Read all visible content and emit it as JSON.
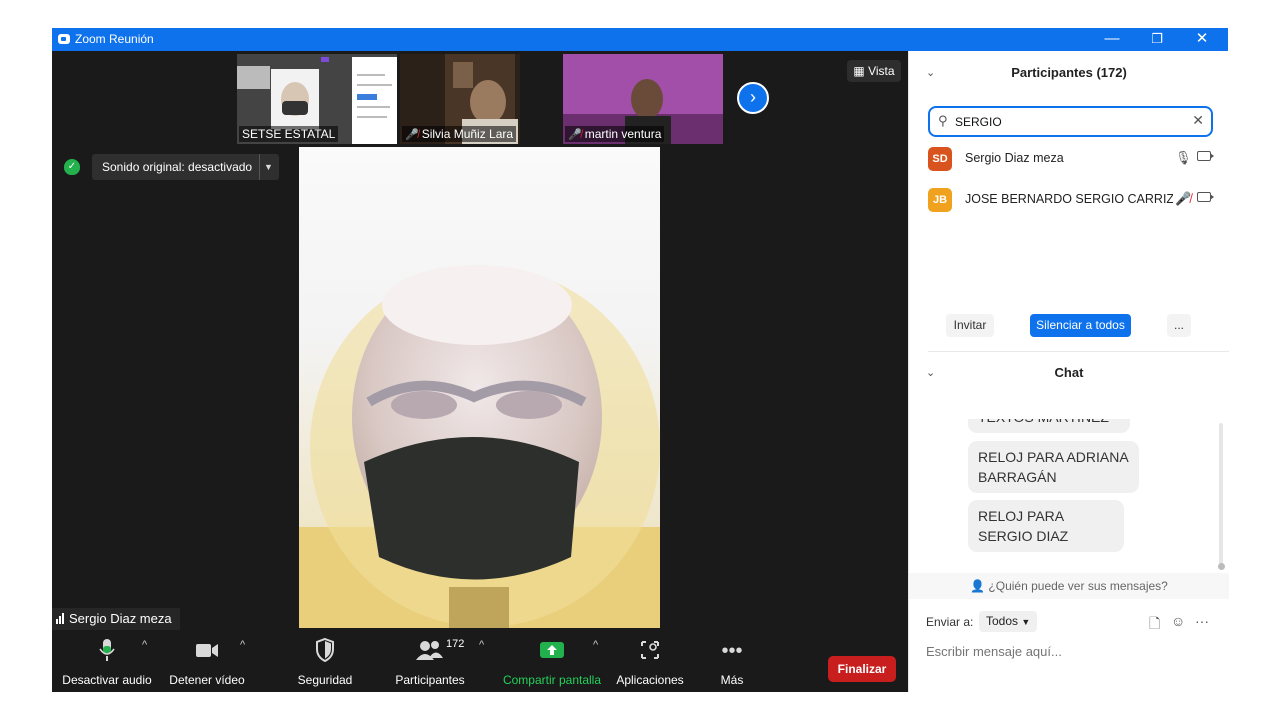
{
  "titlebar": {
    "title": "Zoom Reunión",
    "minimize": "—",
    "restore": "❐",
    "close": "✕"
  },
  "gallery": {
    "tiles": [
      {
        "name": "SETSE ESTATAL",
        "muted": false
      },
      {
        "name": "Silvia Muñiz Lara",
        "muted": true
      },
      {
        "name": "martin ventura",
        "muted": true
      }
    ],
    "next_icon": "›"
  },
  "view_button": "Vista",
  "sound_chip": "Sonido original: desactivado",
  "active_speaker": "Sergio Diaz meza",
  "toolbar": {
    "audio": "Desactivar audio",
    "video": "Detener vídeo",
    "security": "Seguridad",
    "participants": "Participantes",
    "participants_count": "172",
    "share": "Compartir pantalla",
    "apps": "Aplicaciones",
    "more": "Más",
    "end": "Finalizar"
  },
  "participants_panel": {
    "title": "Participantes (172)",
    "search_value": "SERGIO",
    "list": [
      {
        "initials": "SD",
        "name": "Sergio Diaz meza",
        "color": "#d9531e",
        "muted": false
      },
      {
        "initials": "JB",
        "name": "JOSE BERNARDO SERGIO CARRIZ...",
        "color": "#f0a21e",
        "muted": true
      }
    ],
    "invite": "Invitar",
    "mute_all": "Silenciar a todos",
    "more": "..."
  },
  "chat": {
    "title": "Chat",
    "partial_message": "TEXTOS MARTINEZ",
    "messages": [
      "RELOJ PARA ADRIANA BARRAGÁN",
      "RELOJ PARA SERGIO DIAZ"
    ],
    "who_can_see": "¿Quién puede ver sus mensajes?",
    "send_to_label": "Enviar a:",
    "send_to_value": "Todos",
    "input_placeholder": "Escribir mensaje aquí..."
  },
  "colors": {
    "accent": "#0e72ed",
    "end": "#c81e1e",
    "share": "#23b14d"
  }
}
